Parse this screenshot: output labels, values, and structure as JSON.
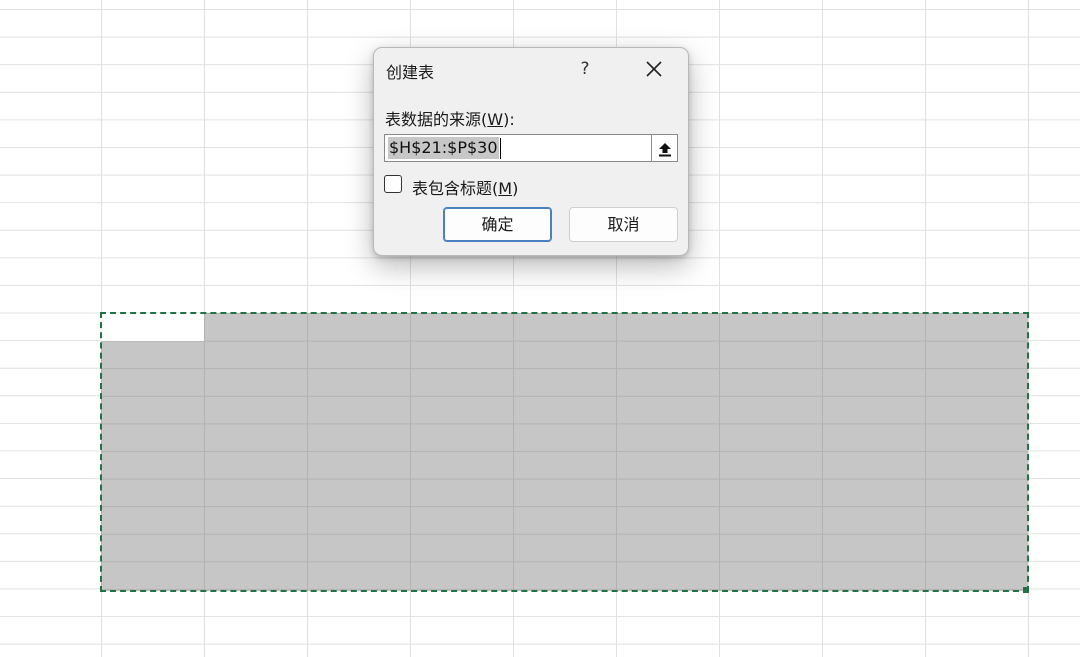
{
  "dialog": {
    "title": "创建表",
    "help_label": "?",
    "source_label_prefix": "表数据的来源(",
    "source_label_accel": "W",
    "source_label_suffix": "):",
    "range_value": "$H$21:$P$30",
    "header_label_prefix": "表包含标题(",
    "header_label_accel": "M",
    "header_label_suffix": ")",
    "header_checked": false,
    "ok_label": "确定",
    "cancel_label": "取消"
  },
  "colors": {
    "selection_border": "#217346",
    "selection_fill": "#c6c6c6",
    "ok_border": "#4a7fc0"
  }
}
